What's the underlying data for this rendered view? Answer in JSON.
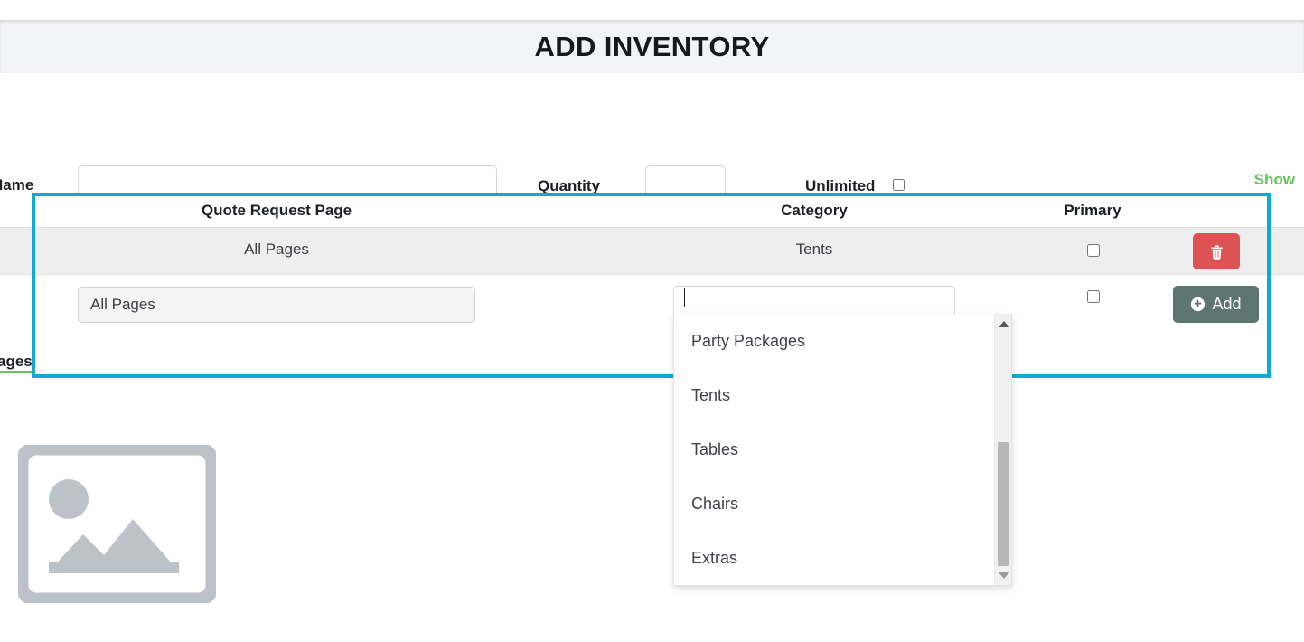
{
  "modal": {
    "title": "ADD INVENTORY"
  },
  "form": {
    "name_label": "Name",
    "name_value": "",
    "name_placeholder": "",
    "quantity_label": "Quantity",
    "quantity_value": "",
    "quantity_placeholder": "",
    "unlimited_label": "Unlimited",
    "unlimited_checked": false,
    "advanced_options_link": "Show Advanced Options"
  },
  "table": {
    "headers": {
      "page": "Quote Request Page",
      "category": "Category",
      "primary": "Primary"
    },
    "existing_rows": [
      {
        "page": "All Pages",
        "category": "Tents",
        "primary_checked": false,
        "delete_icon": "trash-icon"
      }
    ],
    "new_row": {
      "page_value": "All Pages",
      "page_placeholder": "",
      "category_value": "",
      "category_placeholder": "",
      "primary_checked": false,
      "add_button_label": "Add",
      "add_button_icon": "plus-circle-icon"
    }
  },
  "dropdown": {
    "visible": true,
    "options": [
      "Party Packages",
      "Tents",
      "Tables",
      "Chairs",
      "Extras"
    ],
    "scrollbar": {
      "up_arrow_icon": "caret-up-icon",
      "down_arrow_icon": "caret-down-icon"
    }
  },
  "images_section": {
    "label": "ages",
    "placeholder_icon": "image-placeholder-icon"
  },
  "colors": {
    "highlight_border": "#12a8d4",
    "header_bg": "#f1f3f5",
    "link_green": "#5fc35f",
    "delete_red": "#dd5252",
    "add_slate": "#5d7672",
    "row_gray": "#eeeeee",
    "underline_green": "#6ec06e"
  }
}
